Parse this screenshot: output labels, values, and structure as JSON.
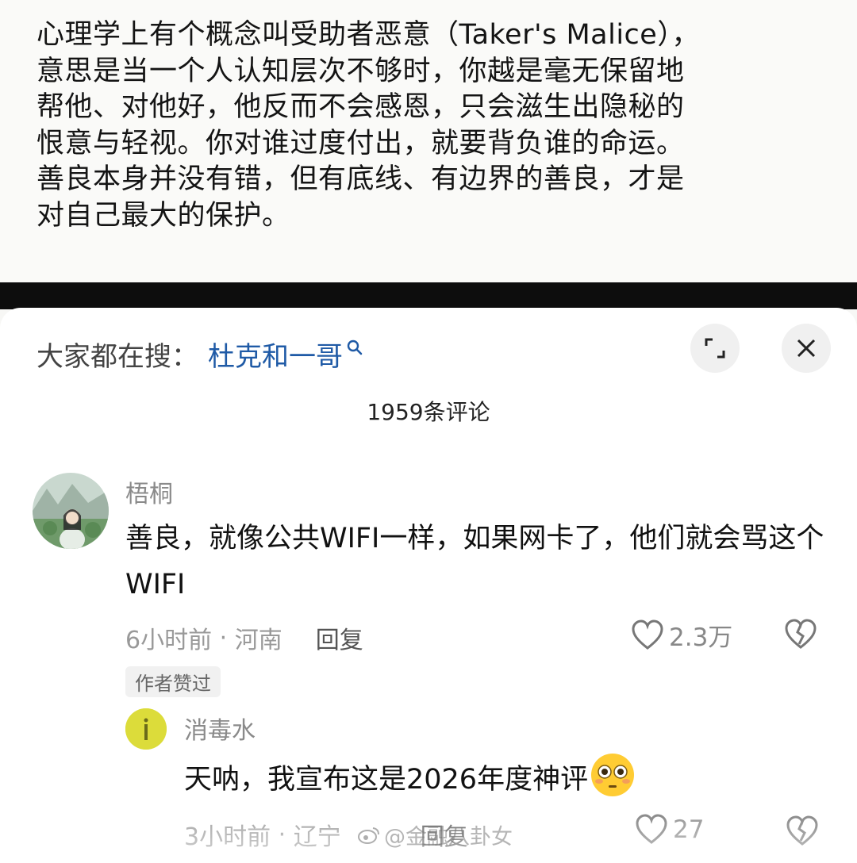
{
  "post": {
    "text": "心理学上有个概念叫受助者恶意（Taker's Malice），意思是当一个人认知层次不够时，你越是毫无保留地帮他、对他好，他反而不会感恩，只会滋生出隐秘的恨意与轻视。你对谁过度付出，就要背负谁的命运。善良本身并没有错，但有底线、有边界的善良，才是对自己最大的保护。"
  },
  "search": {
    "prefix": "大家都在搜：",
    "term": "杜克和一哥"
  },
  "comments_header": {
    "count_label": "1959条评论"
  },
  "comments": [
    {
      "username": "梧桐",
      "text": "善良，就像公共WIFI一样，如果网卡了，他们就会骂这个WIFI",
      "time": "6小时前",
      "location": "河南",
      "reply_label": "回复",
      "likes": "2.3万",
      "badge": "作者赞过"
    },
    {
      "username": "消毒水",
      "text": "天呐，我宣布这是2026年度神评",
      "time": "3小时前",
      "location": "辽宁",
      "reply_label": "回复",
      "likes": "27"
    }
  ],
  "watermark": "@金融八卦女",
  "icons": {
    "search": "search-icon",
    "expand": "expand-icon",
    "close": "close-icon",
    "like": "heart-icon",
    "dislike": "broken-heart-icon",
    "emoji": "flushed-face-emoji"
  },
  "colors": {
    "search_term": "#1f5aa6",
    "reply_avatar": "#dede3c"
  }
}
